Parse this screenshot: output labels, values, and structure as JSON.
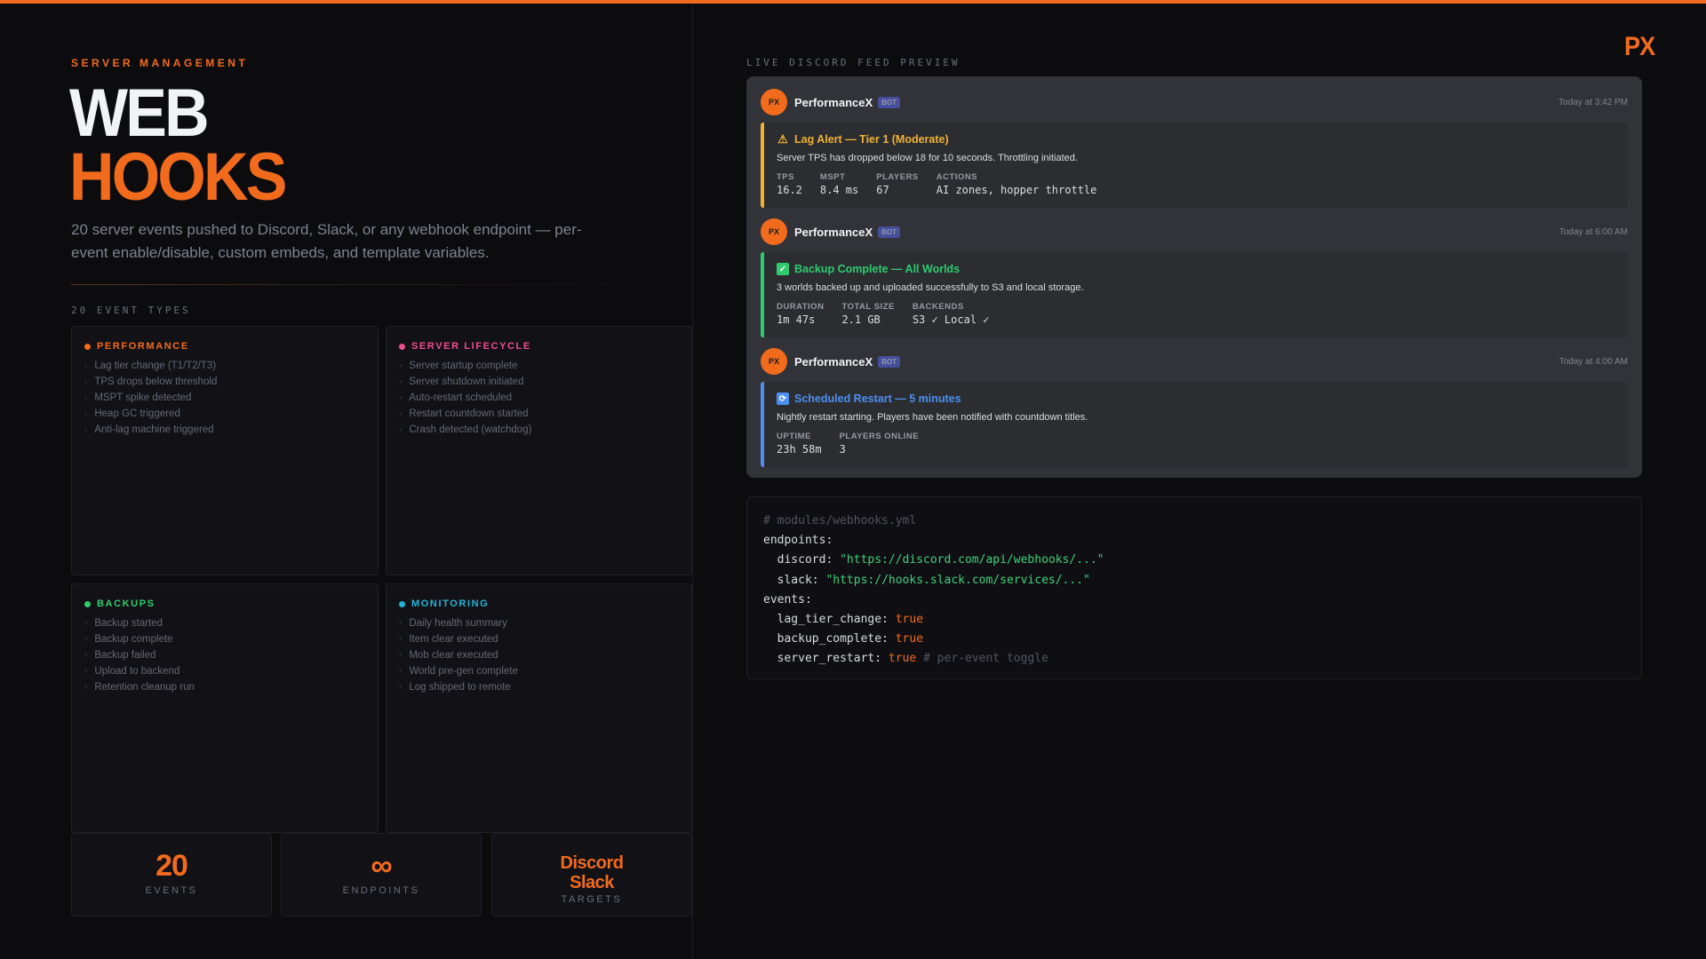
{
  "header": {
    "eyebrow": "SERVER MANAGEMENT",
    "title_line1": "WEB",
    "title_line2": "HOOKS",
    "description": "20 server events pushed to Discord, Slack, or any webhook endpoint — per-event enable/disable, custom embeds, and template variables.",
    "section_label": "20 EVENT TYPES"
  },
  "categories": [
    {
      "title": "PERFORMANCE",
      "color": "#f26b1d",
      "items": [
        "Lag tier change (T1/T2/T3)",
        "TPS drops below threshold",
        "MSPT spike detected",
        "Heap GC triggered",
        "Anti-lag machine triggered"
      ]
    },
    {
      "title": "SERVER LIFECYCLE",
      "color": "#ec4f8f",
      "items": [
        "Server startup complete",
        "Server shutdown initiated",
        "Auto-restart scheduled",
        "Restart countdown started",
        "Crash detected (watchdog)"
      ]
    },
    {
      "title": "BACKUPS",
      "color": "#2fcc6e",
      "items": [
        "Backup started",
        "Backup complete",
        "Backup failed",
        "Upload to backend",
        "Retention cleanup run"
      ]
    },
    {
      "title": "MONITORING",
      "color": "#22b5d8",
      "items": [
        "Daily health summary",
        "Item clear executed",
        "Mob clear executed",
        "World pre-gen complete",
        "Log shipped to remote"
      ]
    }
  ],
  "stats": [
    {
      "value": "20",
      "label": "EVENTS"
    },
    {
      "value": "∞",
      "label": "ENDPOINTS"
    },
    {
      "value_line1": "Discord",
      "value_line2": "Slack",
      "label": "TARGETS"
    }
  ],
  "brand": {
    "logo": "PX"
  },
  "feed": {
    "label": "LIVE DISCORD FEED PREVIEW",
    "messages": [
      {
        "avatar": "PX",
        "username": "PerformanceX",
        "badge": "BOT",
        "time": "Today at 3:42 PM",
        "accent": "#f0b232",
        "icon": "warning-icon",
        "glyph": "⚠",
        "title_color": "#f0b232",
        "title": "Lag Alert — Tier 1 (Moderate)",
        "description": "Server TPS has dropped below 18 for 10 seconds. Throttling initiated.",
        "fields": [
          {
            "name": "TPS",
            "value": "16.2"
          },
          {
            "name": "MSPT",
            "value": "8.4 ms"
          },
          {
            "name": "PLAYERS",
            "value": "67"
          },
          {
            "name": "ACTIONS",
            "value": "AI zones, hopper throttle"
          }
        ]
      },
      {
        "avatar": "PX",
        "username": "PerformanceX",
        "badge": "BOT",
        "time": "Today at 6:00 AM",
        "accent": "#2fcc6e",
        "icon": "check-box-icon",
        "glyph": "✓",
        "title_color": "#2fcc6e",
        "title": "Backup Complete — All Worlds",
        "description": "3 worlds backed up and uploaded successfully to S3 and local storage.",
        "fields": [
          {
            "name": "DURATION",
            "value": "1m 47s"
          },
          {
            "name": "TOTAL SIZE",
            "value": "2.1 GB"
          },
          {
            "name": "BACKENDS",
            "value": "S3 ✓ Local ✓"
          }
        ]
      },
      {
        "avatar": "PX",
        "username": "PerformanceX",
        "badge": "BOT",
        "time": "Today at 4:00 AM",
        "accent": "#4d8ff0",
        "icon": "restart-icon",
        "glyph": "⟳",
        "title_color": "#4d8ff0",
        "title": "Scheduled Restart — 5 minutes",
        "description": "Nightly restart starting. Players have been notified with countdown titles.",
        "fields": [
          {
            "name": "UPTIME",
            "value": "23h 58m"
          },
          {
            "name": "PLAYERS ONLINE",
            "value": "3"
          }
        ]
      }
    ]
  },
  "code": {
    "comment": "# modules/webhooks.yml",
    "endpoints_key": "endpoints:",
    "discord_key": "  discord: ",
    "discord_val": "\"https://discord.com/api/webhooks/...\"",
    "slack_key": "  slack: ",
    "slack_val": "\"https://hooks.slack.com/services/...\"",
    "events_key": "events:",
    "lag_key": "  lag_tier_change: ",
    "backup_key": "  backup_complete: ",
    "restart_key": "  server_restart: ",
    "true_val": "true",
    "toggle_comment": " # per-event toggle"
  }
}
